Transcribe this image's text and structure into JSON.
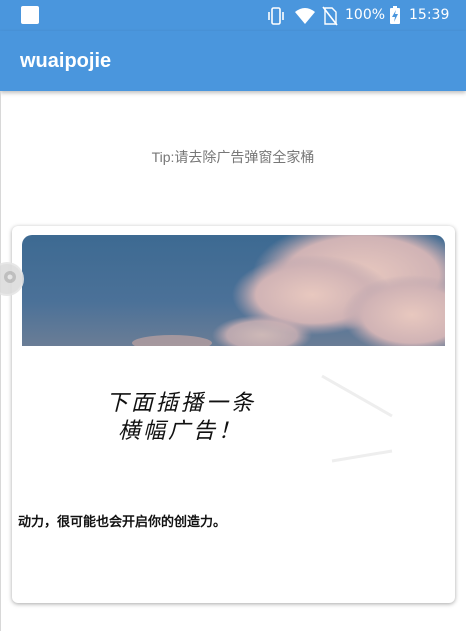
{
  "status_bar": {
    "battery_percent": "100%",
    "time": "15:39",
    "icons": [
      "app-notification-icon",
      "vibrate-icon",
      "wifi-icon",
      "no-sim-icon",
      "battery-charging-icon"
    ]
  },
  "app_bar": {
    "title": "wuaipojie"
  },
  "main": {
    "tip": "Tip:请去除广告弹窗全家桶",
    "card": {
      "banner_image": "night-sky-moon-clouds-image",
      "handwriting": [
        "下面插播一条",
        "横幅广告！"
      ],
      "text": "动力，很可能也会开启你的创造力。"
    }
  },
  "floating_button": {
    "icon": "assistant-bubble-icon"
  },
  "colors": {
    "primary": "#4a96dd",
    "tip_text": "#777777",
    "card_text": "#111111"
  }
}
